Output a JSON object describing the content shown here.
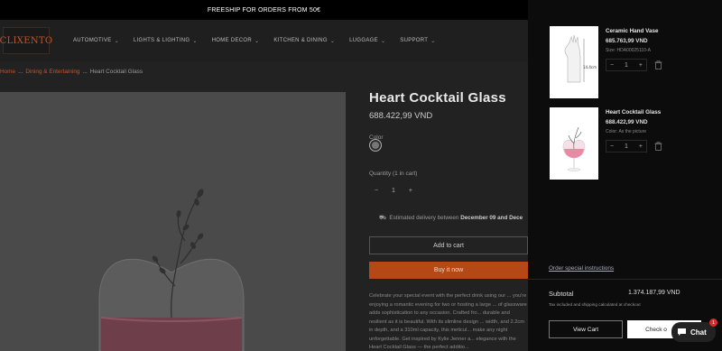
{
  "announcement": "FREESHIP FOR ORDERS FROM 50€",
  "logo_text": "CLIXENTO",
  "nav": [
    {
      "label": "AUTOMOTIVE"
    },
    {
      "label": "LIGHTS & LIGHTING"
    },
    {
      "label": "HOME DECOR"
    },
    {
      "label": "KITCHEN & DINING"
    },
    {
      "label": "LUGGAGE"
    },
    {
      "label": "SUPPORT"
    }
  ],
  "breadcrumb": {
    "home": "Home",
    "sep": "...",
    "category": "Dining & Entertaining",
    "current": "Heart Cocktail Glass"
  },
  "product": {
    "title": "Heart Cocktail Glass",
    "price": "688.422,99 VND",
    "color_label": "Color",
    "quantity_label": "Quantity (1 in cart)",
    "quantity": "1",
    "delivery_prefix": "Estimated delivery between",
    "delivery_dates": "December 09 and Dece",
    "add_to_cart": "Add to cart",
    "buy_now": "Buy it now",
    "description": "Celebrate your special event with the perfect drink using our ... you're enjoying a romantic evening for two or hosting a large ... of glassware adds sophistication to any occasion. Crafted fro... durable and resilient as it is beautiful. With its slimline design ... width, and 2.2cm in depth, and a 310ml capacity, this meticul... make any night unforgettable. Get inspired by Kylie Jenner a... elegance with the Heart Cocktail Glass — the perfect additio..."
  },
  "cart": {
    "items": [
      {
        "name": "Ceramic Hand Vase",
        "price": "685.763,99 VND",
        "variant": "Size: HDA00025110-A",
        "quantity": "1",
        "thumb_label": "14.4cm"
      },
      {
        "name": "Heart Cocktail Glass",
        "price": "688.422,99 VND",
        "variant": "Color: As the picture",
        "quantity": "1"
      }
    ],
    "special_instructions": "Order special instructions",
    "subtotal_label": "Subtotal",
    "subtotal_value": "1.374.187,99 VND",
    "tax_note": "Tax included and shipping calculated at checkout",
    "view_cart": "View Cart",
    "checkout": "Check o",
    "chat_label": "Chat",
    "chat_badge": "1",
    "minus": "−",
    "plus": "+"
  },
  "colors": {
    "accent": "#c1552a",
    "buy_button": "#b54814",
    "drawer_bg": "#0c0c0c"
  }
}
